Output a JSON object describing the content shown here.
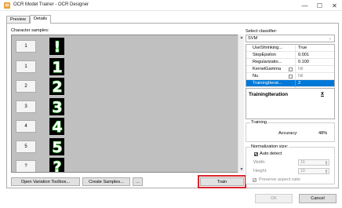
{
  "window": {
    "title": "OCR Model Trainer - OCR Designer",
    "min_glyph": "—",
    "max_glyph": "☐",
    "close_glyph": "✕",
    "icon": "app-icon"
  },
  "tabs": [
    {
      "label": "Preview"
    },
    {
      "label": "Details"
    }
  ],
  "samples": {
    "label": "Character samples:",
    "items": [
      {
        "button": "1",
        "glyph": "!"
      },
      {
        "button": "1",
        "glyph": "1"
      },
      {
        "button": "2",
        "glyph": "2"
      },
      {
        "button": "3",
        "glyph": "3"
      },
      {
        "button": "4",
        "glyph": "4"
      },
      {
        "button": "5",
        "glyph": "5"
      },
      {
        "button": "?",
        "glyph": "?"
      }
    ]
  },
  "toolbar": {
    "open_variation": "Open Variation Toolbox...",
    "create_samples": "Create Samples...",
    "more": "...",
    "train": "Train"
  },
  "classifier": {
    "label": "Select classifier:",
    "selected": "SVM",
    "properties": [
      {
        "name": "UseShrinking...",
        "value": "True",
        "checkbox": false,
        "disabled": false,
        "selected": false
      },
      {
        "name": "StopEpsilon",
        "value": "0.001",
        "checkbox": false,
        "disabled": false,
        "selected": false
      },
      {
        "name": "Regularizatio...",
        "value": "0.100",
        "checkbox": false,
        "disabled": false,
        "selected": false
      },
      {
        "name": "KernelGamma",
        "value": "Nil",
        "checkbox": true,
        "disabled": true,
        "selected": false
      },
      {
        "name": "Nu",
        "value": "Nil",
        "checkbox": true,
        "disabled": true,
        "selected": false
      },
      {
        "name": "TrainingIterat...",
        "value": "2",
        "checkbox": false,
        "disabled": false,
        "selected": true
      }
    ],
    "description_title": "TrainingIteration",
    "description_close": "x"
  },
  "training": {
    "title": "Training",
    "accuracy_label": "Accuracy:",
    "accuracy_value": "48%"
  },
  "normalization": {
    "title": "Normalization size:",
    "auto_detect": "Auto detect",
    "auto_detect_checked": true,
    "width_label": "Width:",
    "width_value": "16",
    "height_label": "Height:",
    "height_value": "19",
    "preserve_label": "Preserve aspect ratio",
    "preserve_checked": true
  },
  "dialog": {
    "ok": "OK",
    "cancel": "Cancel"
  },
  "colors": {
    "highlight": "#0078d7",
    "train_outline": "#d9262c",
    "glyph_fg": "#3ddc3d",
    "glyph_bg": "#000000",
    "samples_bg": "#c0c0c0"
  }
}
